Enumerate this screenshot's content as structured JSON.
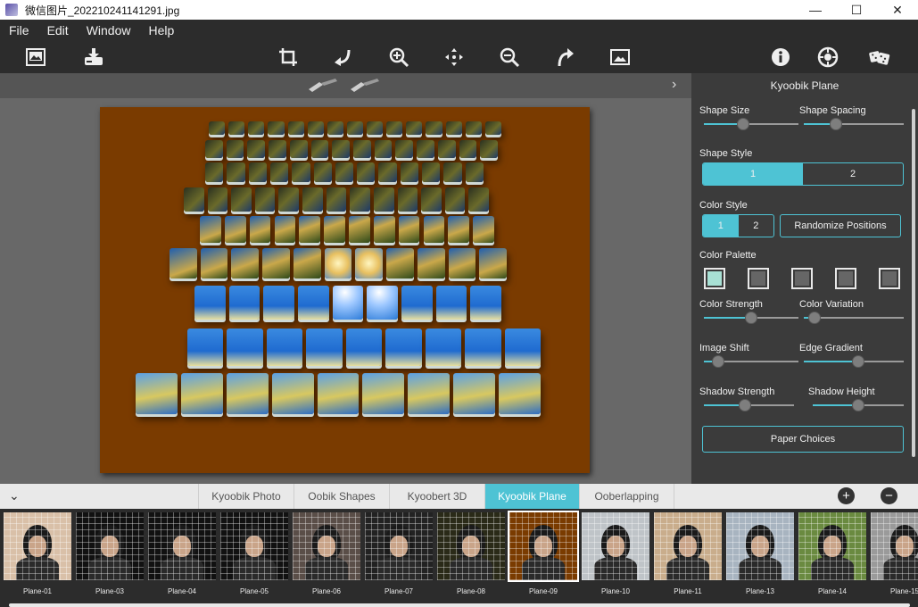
{
  "window": {
    "title": "微信图片_202210241141291.jpg",
    "min": "—",
    "max": "☐",
    "close": "✕"
  },
  "menu": [
    "File",
    "Edit",
    "Window",
    "Help"
  ],
  "toolbar": {
    "icons": [
      "open-image-icon",
      "save-icon",
      "crop-icon",
      "rotate-left-icon",
      "zoom-in-icon",
      "pan-icon",
      "zoom-out-icon",
      "rotate-right-icon",
      "fit-image-icon",
      "info-icon",
      "settings-icon",
      "randomize-dice-icon"
    ]
  },
  "panel": {
    "title": "Kyoobik Plane",
    "shape_size": {
      "label": "Shape Size",
      "value": 0.4
    },
    "shape_spacing": {
      "label": "Shape Spacing",
      "value": 0.3
    },
    "shape_style": {
      "label": "Shape Style",
      "options": [
        "1",
        "2"
      ],
      "selected": "1"
    },
    "color_style": {
      "label": "Color Style",
      "options": [
        "1",
        "2"
      ],
      "selected": "1"
    },
    "randomize_label": "Randomize Positions",
    "color_palette": {
      "label": "Color Palette",
      "swatches": [
        "#a8e0d4",
        "#666666",
        "#666666",
        "#666666",
        "#666666"
      ]
    },
    "color_strength": {
      "label": "Color Strength",
      "value": 0.5
    },
    "color_variation": {
      "label": "Color Variation",
      "value": 0.05
    },
    "image_shift": {
      "label": "Image Shift",
      "value": 0.1
    },
    "edge_gradient": {
      "label": "Edge Gradient",
      "value": 0.55
    },
    "shadow_strength": {
      "label": "Shadow Strength",
      "value": 0.45
    },
    "shadow_height": {
      "label": "Shadow Height",
      "value": 0.5
    },
    "paper_label": "Paper Choices",
    "accent": "#4ec3d4"
  },
  "tabs": {
    "items": [
      "Kyoobik Photo",
      "Oobik Shapes",
      "Kyoobert 3D",
      "Kyoobik Plane",
      "Ooberlapping"
    ],
    "active": "Kyoobik Plane",
    "add": "+",
    "remove": "−",
    "collapse": "⌄"
  },
  "presets": [
    "Plane-01",
    "Plane-03",
    "Plane-04",
    "Plane-05",
    "Plane-06",
    "Plane-07",
    "Plane-08",
    "Plane-09",
    "Plane-10",
    "Plane-11",
    "Plane-13",
    "Plane-14",
    "Plane-15"
  ],
  "selected_preset": "Plane-09"
}
